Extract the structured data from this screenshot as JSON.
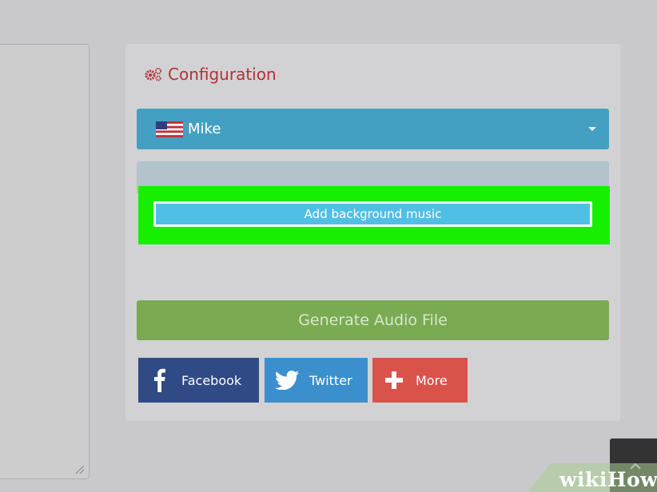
{
  "config": {
    "title": "Configuration",
    "title_color": "#b5303a",
    "icon": "gears-icon"
  },
  "voice_select": {
    "selected": "Mike",
    "flag": "us-flag-icon",
    "color": "#44a0c2"
  },
  "music": {
    "button_label": "Add background music",
    "highlight_color": "#16f000"
  },
  "generate": {
    "label": "Generate Audio File",
    "color": "#7aab52"
  },
  "share": {
    "facebook": "Facebook",
    "twitter": "Twitter",
    "more": "More"
  },
  "watermark": {
    "wiki": "wiki",
    "how": "How"
  }
}
